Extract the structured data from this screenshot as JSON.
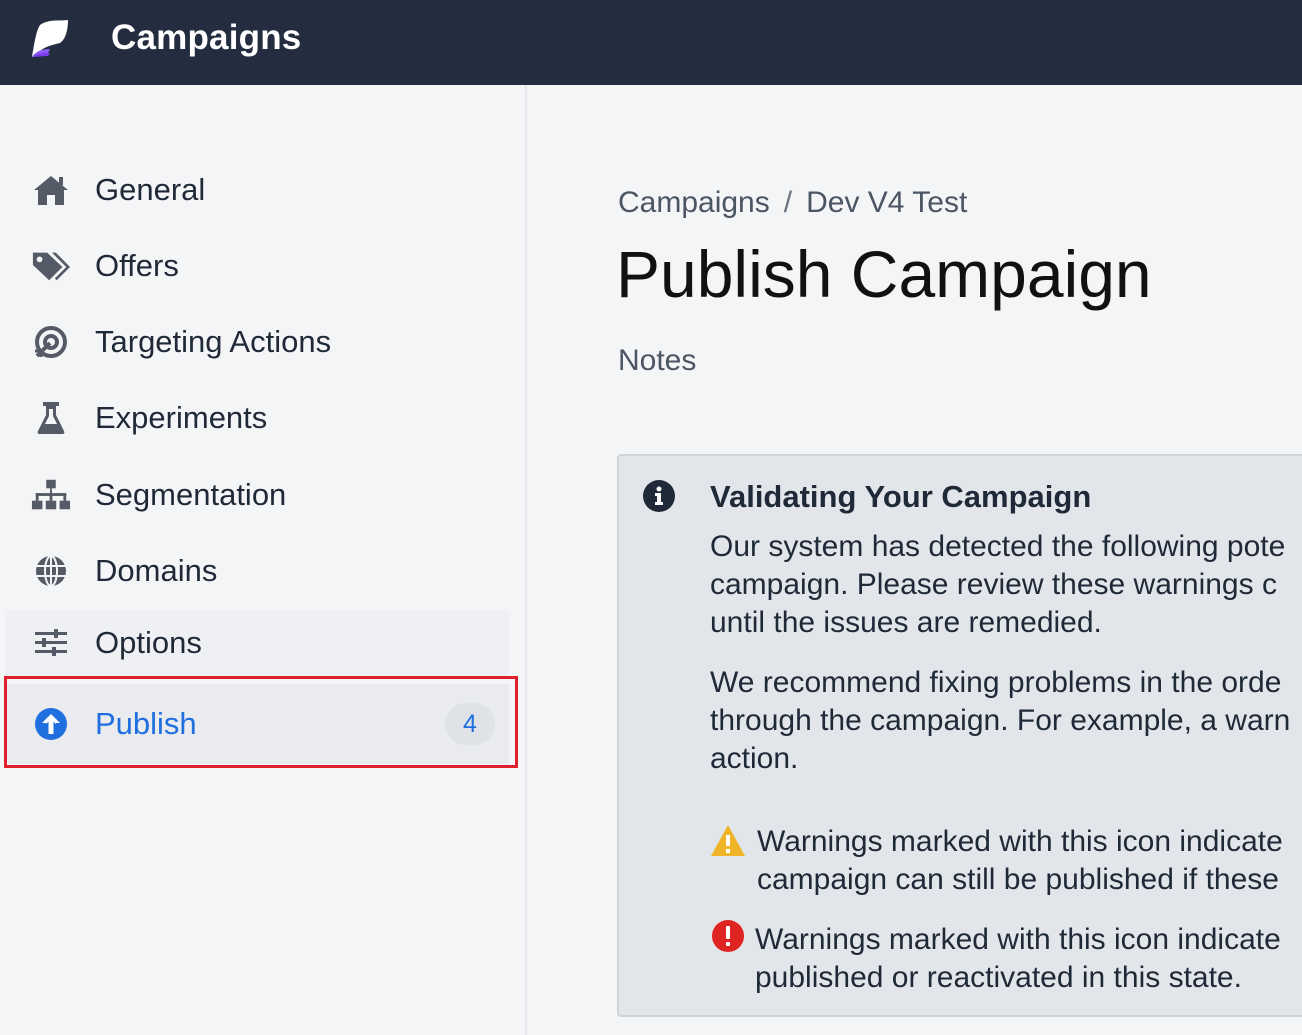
{
  "header": {
    "title": "Campaigns"
  },
  "sidebar": {
    "items": [
      {
        "label": "General",
        "icon": "home-icon"
      },
      {
        "label": "Offers",
        "icon": "tags-icon"
      },
      {
        "label": "Targeting Actions",
        "icon": "target-icon"
      },
      {
        "label": "Experiments",
        "icon": "flask-icon"
      },
      {
        "label": "Segmentation",
        "icon": "sitemap-icon"
      },
      {
        "label": "Domains",
        "icon": "globe-icon"
      },
      {
        "label": "Options",
        "icon": "sliders-icon"
      },
      {
        "label": "Publish",
        "icon": "arrow-up-circle-icon",
        "badge": "4",
        "active": true
      }
    ]
  },
  "main": {
    "breadcrumb": {
      "root": "Campaigns",
      "separator": "/",
      "current": "Dev V4 Test"
    },
    "title": "Publish Campaign",
    "notes_label": "Notes",
    "alert": {
      "title": "Validating Your Campaign",
      "para1_lines": [
        "Our system has detected the following pote",
        "campaign. Please review these warnings c",
        "until the issues are remedied."
      ],
      "para2_lines": [
        "We recommend fixing problems in the orde",
        "through the campaign. For example, a warn",
        "action."
      ],
      "warning_lines": [
        "Warnings marked with this icon indicate",
        "campaign can still be published if these"
      ],
      "error_lines": [
        "Warnings marked with this icon indicate",
        "published or reactivated in this state."
      ]
    }
  },
  "colors": {
    "topbar": "#232d3f",
    "active": "#1f6fde",
    "warning": "#f0b429",
    "error": "#e02424",
    "highlight": "#e0202a"
  }
}
